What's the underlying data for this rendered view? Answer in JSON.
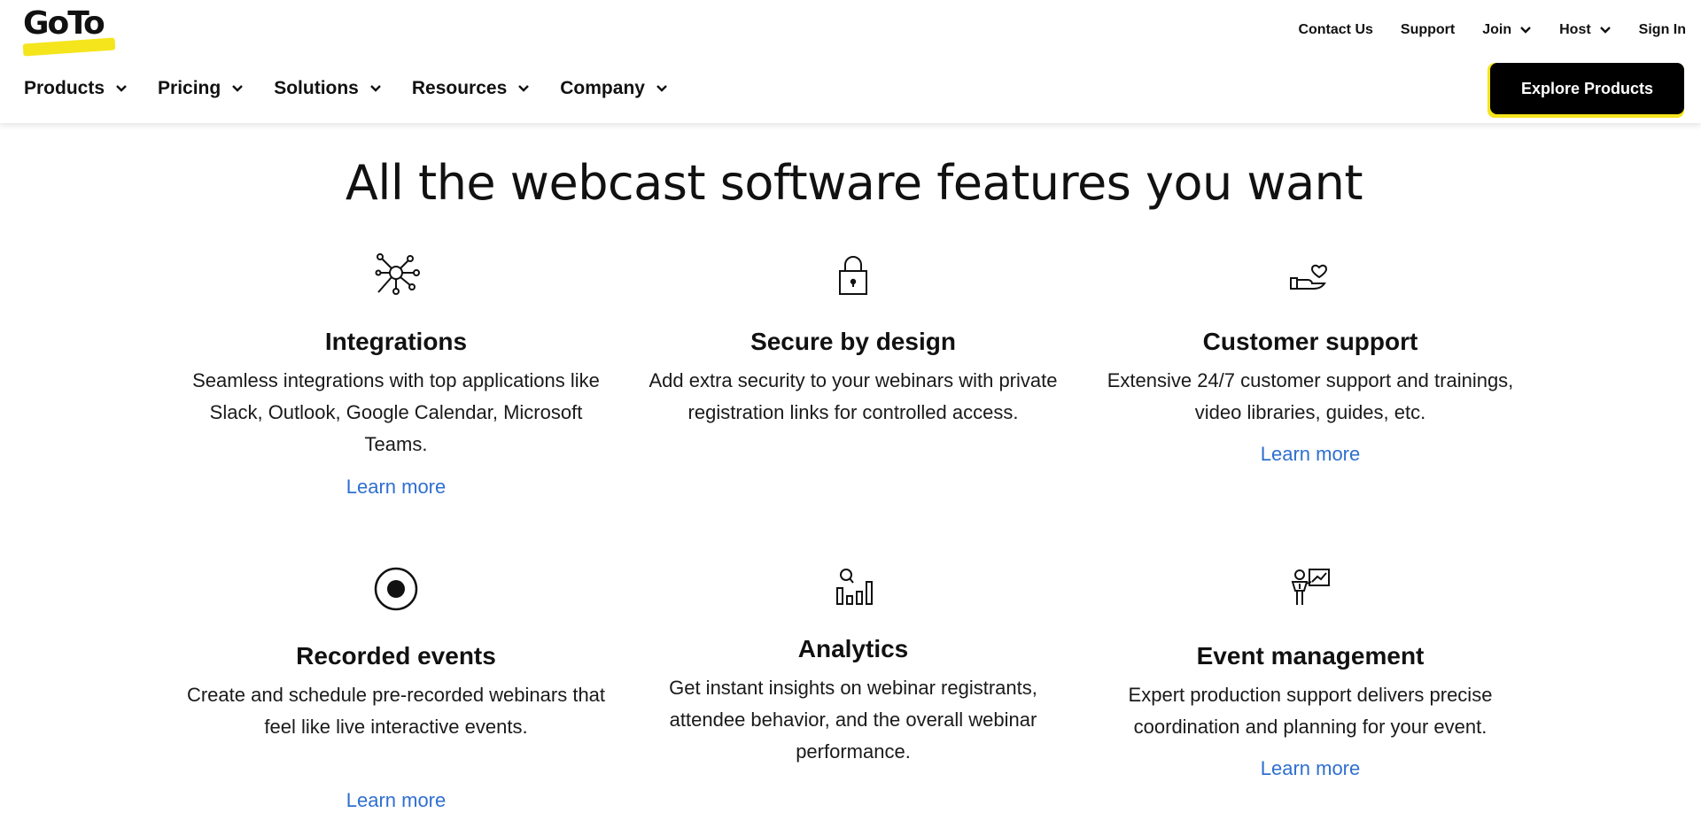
{
  "brand": {
    "logo_text": "GoTo",
    "accent": "#f5e51d",
    "link_color": "#2f6fd0"
  },
  "utility_nav": [
    {
      "label": "Contact Us",
      "has_menu": false
    },
    {
      "label": "Support",
      "has_menu": false
    },
    {
      "label": "Join",
      "has_menu": true
    },
    {
      "label": "Host",
      "has_menu": true
    },
    {
      "label": "Sign In",
      "has_menu": false
    }
  ],
  "main_nav": [
    {
      "label": "Products"
    },
    {
      "label": "Pricing"
    },
    {
      "label": "Solutions"
    },
    {
      "label": "Resources"
    },
    {
      "label": "Company"
    }
  ],
  "cta": {
    "label": "Explore Products"
  },
  "headline": "All the webcast software features you want",
  "features": [
    {
      "icon": "integrations-network-icon",
      "title": "Integrations",
      "description": "Seamless integrations with top applications like Slack, Outlook, Google Calendar, Microsoft Teams.",
      "link": "Learn more"
    },
    {
      "icon": "padlock-icon",
      "title": "Secure by design",
      "description": "Add extra security to your webinars with private registration links for controlled access.",
      "link": ""
    },
    {
      "icon": "hand-heart-icon",
      "title": "Customer support",
      "description": "Extensive 24/7 customer support and trainings, video libraries, guides, etc.",
      "link": "Learn more"
    },
    {
      "icon": "record-icon",
      "title": "Recorded events",
      "description": "Create and schedule pre-recorded webinars that feel like live interactive events.",
      "link": "Learn more"
    },
    {
      "icon": "analytics-chart-icon",
      "title": "Analytics",
      "description": "Get instant insights on webinar registrants, attendee behavior, and the overall webinar performance.",
      "link": ""
    },
    {
      "icon": "presenter-board-icon",
      "title": "Event management",
      "description": "Expert production support delivers precise coordination and planning for your event.",
      "link": "Learn more"
    }
  ]
}
